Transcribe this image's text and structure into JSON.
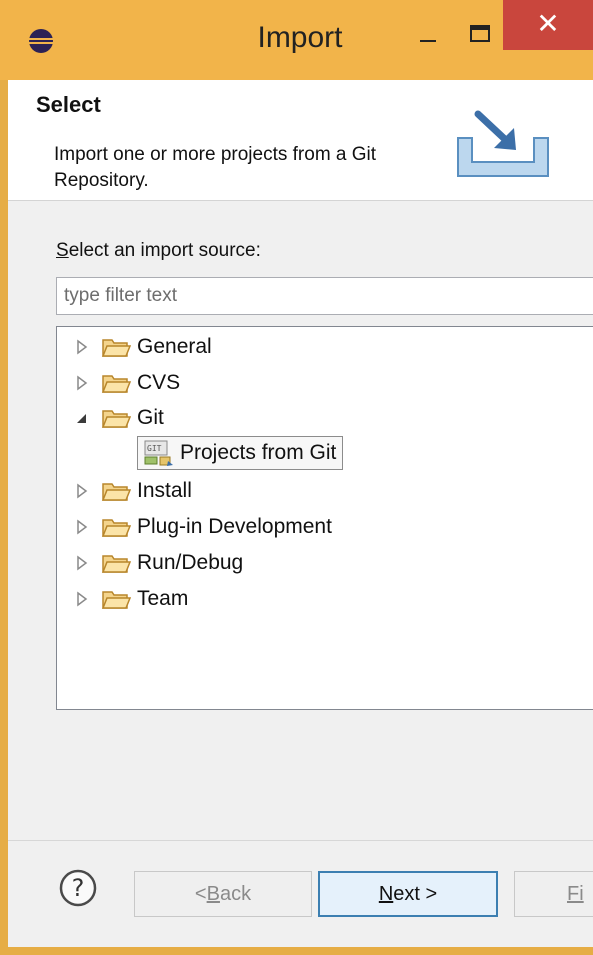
{
  "window": {
    "title": "Import",
    "close_glyph": "✕"
  },
  "banner": {
    "title": "Select",
    "description": "Import one or more projects from a Git Repository.",
    "icon": "import-wizard-icon"
  },
  "source": {
    "label_first": "S",
    "label_rest": "elect an import source:",
    "filter_placeholder": "type filter text"
  },
  "tree": {
    "items": [
      {
        "label": "General",
        "expanded": false
      },
      {
        "label": "CVS",
        "expanded": false
      },
      {
        "label": "Git",
        "expanded": true,
        "children": [
          {
            "label": "Projects from Git",
            "selected": true
          }
        ]
      },
      {
        "label": "Install",
        "expanded": false
      },
      {
        "label": "Plug-in Development",
        "expanded": false
      },
      {
        "label": "Run/Debug",
        "expanded": false
      },
      {
        "label": "Team",
        "expanded": false
      }
    ]
  },
  "buttons": {
    "help": "?",
    "back_prefix": "< ",
    "back_mnemonic": "B",
    "back_rest": "ack",
    "next_mnemonic": "N",
    "next_rest": "ext >",
    "finish_mnemonic": "Fi"
  },
  "colors": {
    "title_bar": "#f2b44a",
    "close_button": "#c9463d",
    "default_button_border": "#3c7fb1",
    "folder": "#e8b54a"
  }
}
